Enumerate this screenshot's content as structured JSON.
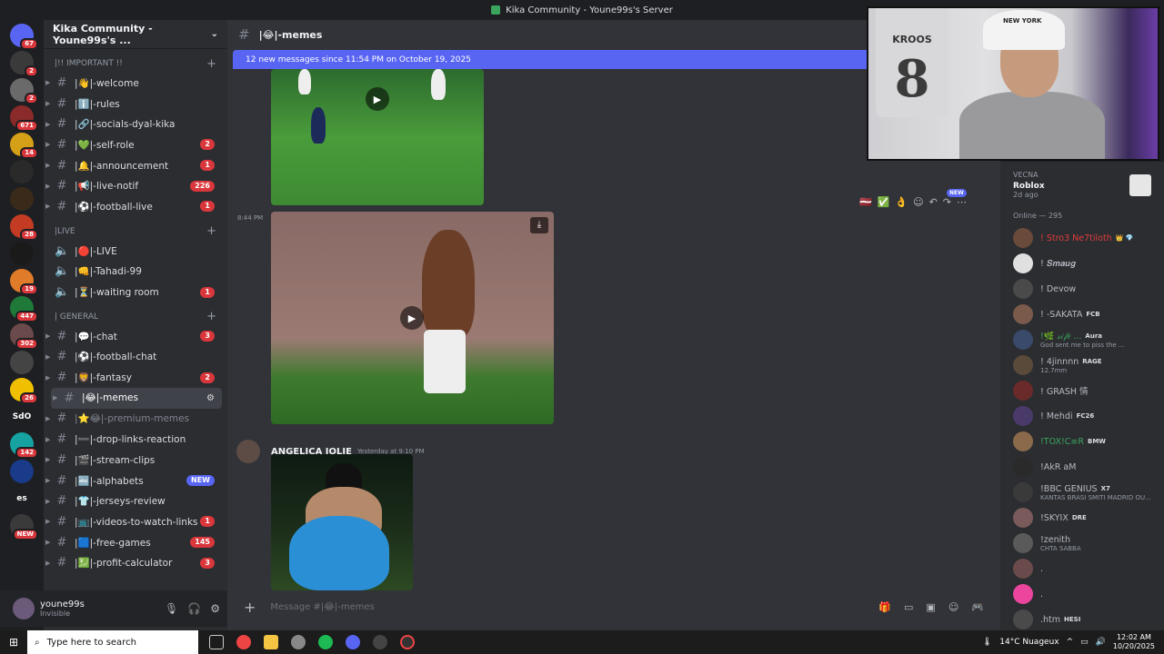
{
  "window": {
    "title": "Kika Community - Youne99s's Server"
  },
  "server_badges": [
    "67",
    "2",
    "2",
    "671",
    "14",
    "",
    "",
    "28",
    "",
    "19",
    "447",
    "302",
    "",
    "26",
    "",
    "142",
    "",
    "",
    "NEW"
  ],
  "server_labels": {
    "sdo": "SdO",
    "es": "es"
  },
  "guild": {
    "name": "Kika Community - Youne99s's ..."
  },
  "categories": {
    "important": "|!! IMPORTANT !!",
    "live": "|LIVE",
    "general": "| GENERAL"
  },
  "channels_important": [
    {
      "name": "|👋|-welcome",
      "badge": ""
    },
    {
      "name": "|ℹ️|-rules",
      "badge": ""
    },
    {
      "name": "|🔗|-socials-dyal-kika",
      "badge": ""
    },
    {
      "name": "|💚|-self-role",
      "badge": "2"
    },
    {
      "name": "|🔔|-announcement",
      "badge": "1"
    },
    {
      "name": "|📢|-live-notif",
      "badge": "226"
    },
    {
      "name": "|⚽|-football-live",
      "badge": "1"
    }
  ],
  "channels_live": [
    {
      "name": "|🔴|-LIVE",
      "badge": ""
    },
    {
      "name": "|👊|-Tahadi-99",
      "badge": ""
    },
    {
      "name": "|⏳|-waiting room",
      "badge": "1"
    }
  ],
  "channels_general": [
    {
      "name": "|💬|-chat",
      "badge": "3"
    },
    {
      "name": "|⚽|-football-chat",
      "badge": ""
    },
    {
      "name": "|🦁|-fantasy",
      "badge": "2"
    },
    {
      "name": "|😂|-memes",
      "badge": ""
    },
    {
      "name": "|⭐😂|-premium-memes",
      "badge": ""
    },
    {
      "name": "|➖|-drop-links-reaction",
      "badge": ""
    },
    {
      "name": "|🎬|-stream-clips",
      "badge": ""
    },
    {
      "name": "|🔤|-alphabets",
      "badge": "NEW"
    },
    {
      "name": "|👕|-jerseys-review",
      "badge": ""
    },
    {
      "name": "|📺|-videos-to-watch-links",
      "badge": "1"
    },
    {
      "name": "|🟦|-free-games",
      "badge": "145"
    },
    {
      "name": "|💹|-profit-calculator",
      "badge": "3"
    }
  ],
  "user": {
    "name": "youne99s",
    "status": "Invisible"
  },
  "channel_header": {
    "title": "|😂|-memes"
  },
  "new_messages_bar": "12 new messages since 11:54 PM on October 19, 2025",
  "message1": {
    "time": "8:44 PM"
  },
  "message2": {
    "author": "ANGELICA JOLIE",
    "timestamp": "Yesterday at 9:10 PM"
  },
  "new_pill": "NEW",
  "composer": {
    "placeholder": "Message #|😂|-memes"
  },
  "webcam": {
    "shirt_name": "KROOS",
    "shirt_number": "8",
    "cap_text": "NEW YORK"
  },
  "activity": {
    "user": "VECNA",
    "game": "Roblox",
    "when": "2d ago"
  },
  "online_header": "Online — 295",
  "members": [
    {
      "name": "! Stro3 Ne7tiloth",
      "tag": "👑 💎",
      "sub": "",
      "color": "#e23c3c",
      "av": "#6a4a3a"
    },
    {
      "name": "! 𝑺𝒎𝒂𝒖𝒈",
      "tag": "",
      "sub": "",
      "color": "#b5bac1",
      "av": "#e0e0e0"
    },
    {
      "name": "! Devow",
      "tag": "",
      "sub": "",
      "color": "#b5bac1",
      "av": "#4a4a4a"
    },
    {
      "name": "! -SAKATA",
      "tag": "FCB",
      "sub": "",
      "color": "#b5bac1",
      "av": "#7a5a4a"
    },
    {
      "name": "!🌿 𝓈𝒾𝒻𝑒 ...",
      "tag": "Aura",
      "sub": "God sent me to piss the ...",
      "color": "#3ba55d",
      "av": "#3a4a6a"
    },
    {
      "name": "! 4jinnnn",
      "tag": "RAGE",
      "sub": "12.7mm",
      "color": "#b5bac1",
      "av": "#5a4a3a"
    },
    {
      "name": "! GRASH 情",
      "tag": "",
      "sub": "",
      "color": "#b5bac1",
      "av": "#6a2a2a"
    },
    {
      "name": "! Mehdi",
      "tag": "FC26",
      "sub": "",
      "color": "#b5bac1",
      "av": "#4a3a6a"
    },
    {
      "name": "!TOX!C≡R",
      "tag": "BMW",
      "sub": "",
      "color": "#3ba55d",
      "av": "#8a6a4a"
    },
    {
      "name": "!AkR aM",
      "tag": "",
      "sub": "",
      "color": "#b5bac1",
      "av": "#2a2a2a"
    },
    {
      "name": "!BBC GENIUS",
      "tag": "X7",
      "sub": "KANTAS BRASI SMITI MADRID OU...",
      "color": "#b5bac1",
      "av": "#3a3a3a"
    },
    {
      "name": "!SKYIX",
      "tag": "DRE",
      "sub": "",
      "color": "#b5bac1",
      "av": "#7a5a5a"
    },
    {
      "name": "!zenith",
      "tag": "",
      "sub": "CHTA SABBA",
      "color": "#b5bac1",
      "av": "#5a5a5a"
    },
    {
      "name": ".",
      "tag": "",
      "sub": "",
      "color": "#b5bac1",
      "av": "#6a4a4a"
    },
    {
      "name": ".",
      "tag": "",
      "sub": "",
      "color": "#b5bac1",
      "av": "#eb459e"
    },
    {
      "name": ".htm",
      "tag": "HESI",
      "sub": "",
      "color": "#b5bac1",
      "av": "#4a4a4a"
    }
  ],
  "taskbar": {
    "search_placeholder": "Type here to search",
    "weather": "14°C  Nuageux",
    "time": "12:02 AM",
    "date": "10/20/2025"
  }
}
